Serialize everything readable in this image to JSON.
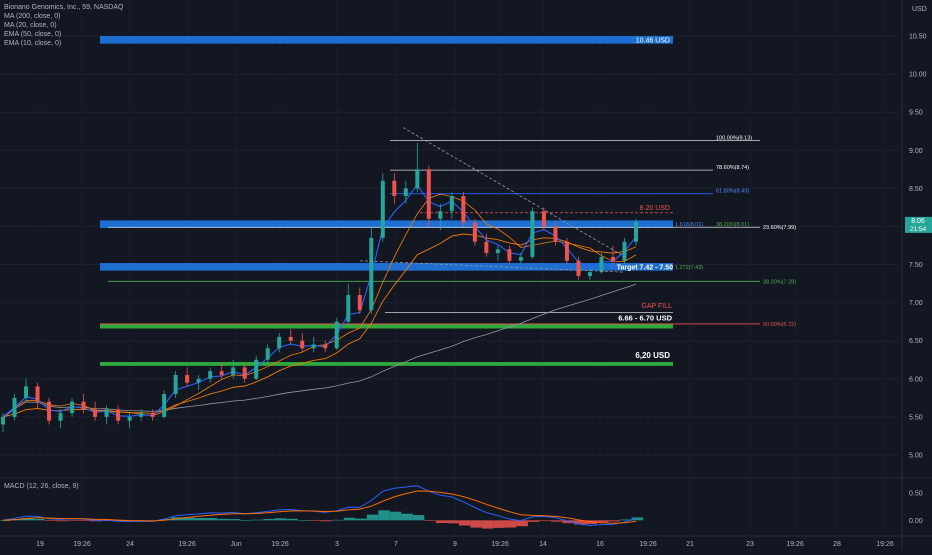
{
  "legend": {
    "title": "Bionano Genomics, Inc., 59, NASDAQ",
    "indicators": [
      "MA (200, close, 0)",
      "MA (20, close, 0)",
      "EMA (50, close, 0)",
      "EMA (10, close, 0)"
    ],
    "macd": "MACD (12, 26, close, 9)"
  },
  "axis": {
    "currency": "USD",
    "price_ticks": [
      "10.50",
      "10.00",
      "9.50",
      "9.00",
      "8.50",
      "8.00",
      "7.50",
      "7.00",
      "6.50",
      "6.00",
      "5.50",
      "5.00"
    ],
    "macd_ticks": [
      "0.50",
      "0.00"
    ],
    "time_ticks": [
      "19",
      "19:26",
      "24",
      "19:26",
      "Jun",
      "19:26",
      "3",
      "7",
      "9",
      "19:26",
      "14",
      "16",
      "19:26",
      "21",
      "23",
      "19:26",
      "28",
      "19:26"
    ],
    "last_price": "8.06",
    "countdown": "21:54"
  },
  "colors": {
    "background": "#131722",
    "up": "#26a69a",
    "down": "#ef5350",
    "zone_blue": "#1e6fd1",
    "zone_green": "#2fa83c",
    "ma_blue": "#2962ff",
    "ma_orange": "#f57c00",
    "ma_gray": "#9598a1"
  },
  "annotations": {
    "z1046": "10.46 USD",
    "z820": "8.20 USD",
    "target": "Target 7.42 - 7.50",
    "gapfill": "GAP FILL",
    "z666": "6.66 - 6.70 USD",
    "z620": "6,20 USD",
    "fib_100": "100.00%(9.13)",
    "fib_786": "78.60%(8.74)",
    "fib_618": "61.80%(8.43)",
    "fib_236": "23.60%(7.99)",
    "fib_1618": "1.618(8.01)",
    "fib_382a": "38.20%(8.01)",
    "fib_1272": "1.272(7.43)",
    "fib_382b": "38.20%(7.28)",
    "fib_50": "50.00%(6.72)"
  },
  "chart_data": {
    "type": "candlestick",
    "title": "Bionano Genomics, Inc., 59, NASDAQ",
    "ylabel": "USD",
    "ylim": [
      4.75,
      10.75
    ],
    "candles": [
      {
        "x": "19",
        "o": 5.4,
        "h": 5.55,
        "l": 5.3,
        "c": 5.5
      },
      {
        "x": "19",
        "o": 5.5,
        "h": 5.8,
        "l": 5.45,
        "c": 5.75
      },
      {
        "x": "",
        "o": 5.75,
        "h": 6.0,
        "l": 5.7,
        "c": 5.9
      },
      {
        "x": "",
        "o": 5.9,
        "h": 5.95,
        "l": 5.6,
        "c": 5.7
      },
      {
        "x": "",
        "o": 5.7,
        "h": 5.75,
        "l": 5.4,
        "c": 5.45
      },
      {
        "x": "",
        "o": 5.45,
        "h": 5.6,
        "l": 5.35,
        "c": 5.55
      },
      {
        "x": "19:26",
        "o": 5.55,
        "h": 5.75,
        "l": 5.5,
        "c": 5.7
      },
      {
        "x": "",
        "o": 5.7,
        "h": 5.8,
        "l": 5.55,
        "c": 5.6
      },
      {
        "x": "",
        "o": 5.6,
        "h": 5.7,
        "l": 5.45,
        "c": 5.5
      },
      {
        "x": "24",
        "o": 5.5,
        "h": 5.65,
        "l": 5.4,
        "c": 5.6
      },
      {
        "x": "",
        "o": 5.6,
        "h": 5.65,
        "l": 5.4,
        "c": 5.45
      },
      {
        "x": "",
        "o": 5.45,
        "h": 5.55,
        "l": 5.35,
        "c": 5.5
      },
      {
        "x": "",
        "o": 5.5,
        "h": 5.6,
        "l": 5.45,
        "c": 5.55
      },
      {
        "x": "",
        "o": 5.55,
        "h": 5.6,
        "l": 5.45,
        "c": 5.5
      },
      {
        "x": "",
        "o": 5.5,
        "h": 5.85,
        "l": 5.48,
        "c": 5.8
      },
      {
        "x": "",
        "o": 5.8,
        "h": 6.1,
        "l": 5.75,
        "c": 6.05
      },
      {
        "x": "19:26",
        "o": 6.05,
        "h": 6.15,
        "l": 5.9,
        "c": 5.95
      },
      {
        "x": "",
        "o": 5.95,
        "h": 6.05,
        "l": 5.85,
        "c": 6.0
      },
      {
        "x": "",
        "o": 6.0,
        "h": 6.15,
        "l": 5.95,
        "c": 6.1
      },
      {
        "x": "",
        "o": 6.1,
        "h": 6.2,
        "l": 6.0,
        "c": 6.05
      },
      {
        "x": "Jun",
        "o": 6.05,
        "h": 6.25,
        "l": 6.0,
        "c": 6.15
      },
      {
        "x": "",
        "o": 6.15,
        "h": 6.2,
        "l": 5.95,
        "c": 6.0
      },
      {
        "x": "",
        "o": 6.0,
        "h": 6.3,
        "l": 5.98,
        "c": 6.25
      },
      {
        "x": "",
        "o": 6.25,
        "h": 6.45,
        "l": 6.2,
        "c": 6.4
      },
      {
        "x": "19:26",
        "o": 6.4,
        "h": 6.6,
        "l": 6.35,
        "c": 6.55
      },
      {
        "x": "",
        "o": 6.55,
        "h": 6.65,
        "l": 6.45,
        "c": 6.5
      },
      {
        "x": "",
        "o": 6.5,
        "h": 6.6,
        "l": 6.35,
        "c": 6.4
      },
      {
        "x": "3",
        "o": 6.4,
        "h": 6.55,
        "l": 6.35,
        "c": 6.45
      },
      {
        "x": "",
        "o": 6.45,
        "h": 6.5,
        "l": 6.35,
        "c": 6.4
      },
      {
        "x": "",
        "o": 6.4,
        "h": 6.8,
        "l": 6.38,
        "c": 6.75
      },
      {
        "x": "",
        "o": 6.75,
        "h": 7.25,
        "l": 6.7,
        "c": 7.1
      },
      {
        "x": "",
        "o": 7.1,
        "h": 7.2,
        "l": 6.85,
        "c": 6.9
      },
      {
        "x": "7",
        "o": 6.9,
        "h": 8.0,
        "l": 6.85,
        "c": 7.85
      },
      {
        "x": "",
        "o": 7.85,
        "h": 8.7,
        "l": 7.8,
        "c": 8.6
      },
      {
        "x": "",
        "o": 8.6,
        "h": 8.7,
        "l": 8.3,
        "c": 8.4
      },
      {
        "x": "",
        "o": 8.4,
        "h": 8.6,
        "l": 8.3,
        "c": 8.5
      },
      {
        "x": "",
        "o": 8.5,
        "h": 9.1,
        "l": 8.45,
        "c": 8.75
      },
      {
        "x": "",
        "o": 8.75,
        "h": 8.8,
        "l": 8.0,
        "c": 8.1
      },
      {
        "x": "9",
        "o": 8.1,
        "h": 8.3,
        "l": 7.95,
        "c": 8.2
      },
      {
        "x": "",
        "o": 8.2,
        "h": 8.45,
        "l": 8.1,
        "c": 8.4
      },
      {
        "x": "",
        "o": 8.4,
        "h": 8.45,
        "l": 8.0,
        "c": 8.05
      },
      {
        "x": "",
        "o": 8.05,
        "h": 8.1,
        "l": 7.75,
        "c": 7.8
      },
      {
        "x": "19:26",
        "o": 7.8,
        "h": 7.9,
        "l": 7.6,
        "c": 7.65
      },
      {
        "x": "",
        "o": 7.65,
        "h": 7.75,
        "l": 7.55,
        "c": 7.7
      },
      {
        "x": "",
        "o": 7.7,
        "h": 7.75,
        "l": 7.5,
        "c": 7.55
      },
      {
        "x": "",
        "o": 7.55,
        "h": 7.65,
        "l": 7.5,
        "c": 7.6
      },
      {
        "x": "14",
        "o": 7.6,
        "h": 8.25,
        "l": 7.58,
        "c": 8.2
      },
      {
        "x": "",
        "o": 8.2,
        "h": 8.25,
        "l": 7.95,
        "c": 8.0
      },
      {
        "x": "",
        "o": 8.0,
        "h": 8.05,
        "l": 7.75,
        "c": 7.8
      },
      {
        "x": "",
        "o": 7.8,
        "h": 7.85,
        "l": 7.5,
        "c": 7.55
      },
      {
        "x": "16",
        "o": 7.55,
        "h": 7.6,
        "l": 7.3,
        "c": 7.35
      },
      {
        "x": "",
        "o": 7.35,
        "h": 7.45,
        "l": 7.3,
        "c": 7.4
      },
      {
        "x": "",
        "o": 7.4,
        "h": 7.65,
        "l": 7.38,
        "c": 7.6
      },
      {
        "x": "",
        "o": 7.6,
        "h": 7.75,
        "l": 7.5,
        "c": 7.55
      },
      {
        "x": "",
        "o": 7.55,
        "h": 7.85,
        "l": 7.5,
        "c": 7.8
      },
      {
        "x": "19:26",
        "o": 7.8,
        "h": 8.1,
        "l": 7.75,
        "c": 8.06
      }
    ],
    "macd_ylim": [
      -0.25,
      0.7
    ]
  }
}
